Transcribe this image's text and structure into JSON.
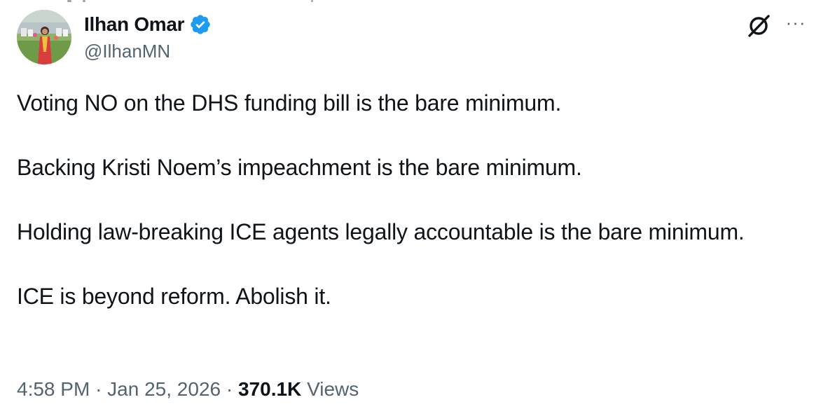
{
  "author": {
    "display_name": "Ilhan Omar",
    "handle": "@IlhanMN",
    "verified_badge_color": "#1d9bf0"
  },
  "actions": {
    "grok_icon": "grok-icon",
    "more_label": "···"
  },
  "tweet": {
    "paragraphs": [
      "Voting NO on the DHS funding bill is the bare minimum.",
      "Backing Kristi Noem’s impeachment is the bare minimum.",
      "Holding law-breaking ICE agents legally accountable is the bare minimum.",
      "ICE is beyond reform. Abolish it."
    ]
  },
  "meta": {
    "time": "4:58 PM",
    "separator": "·",
    "date": "Jan 25, 2026",
    "views_count": "370.1K",
    "views_label": "Views"
  },
  "colors": {
    "text": "#0f1419",
    "secondary": "#536471",
    "accent": "#1d9bf0"
  }
}
